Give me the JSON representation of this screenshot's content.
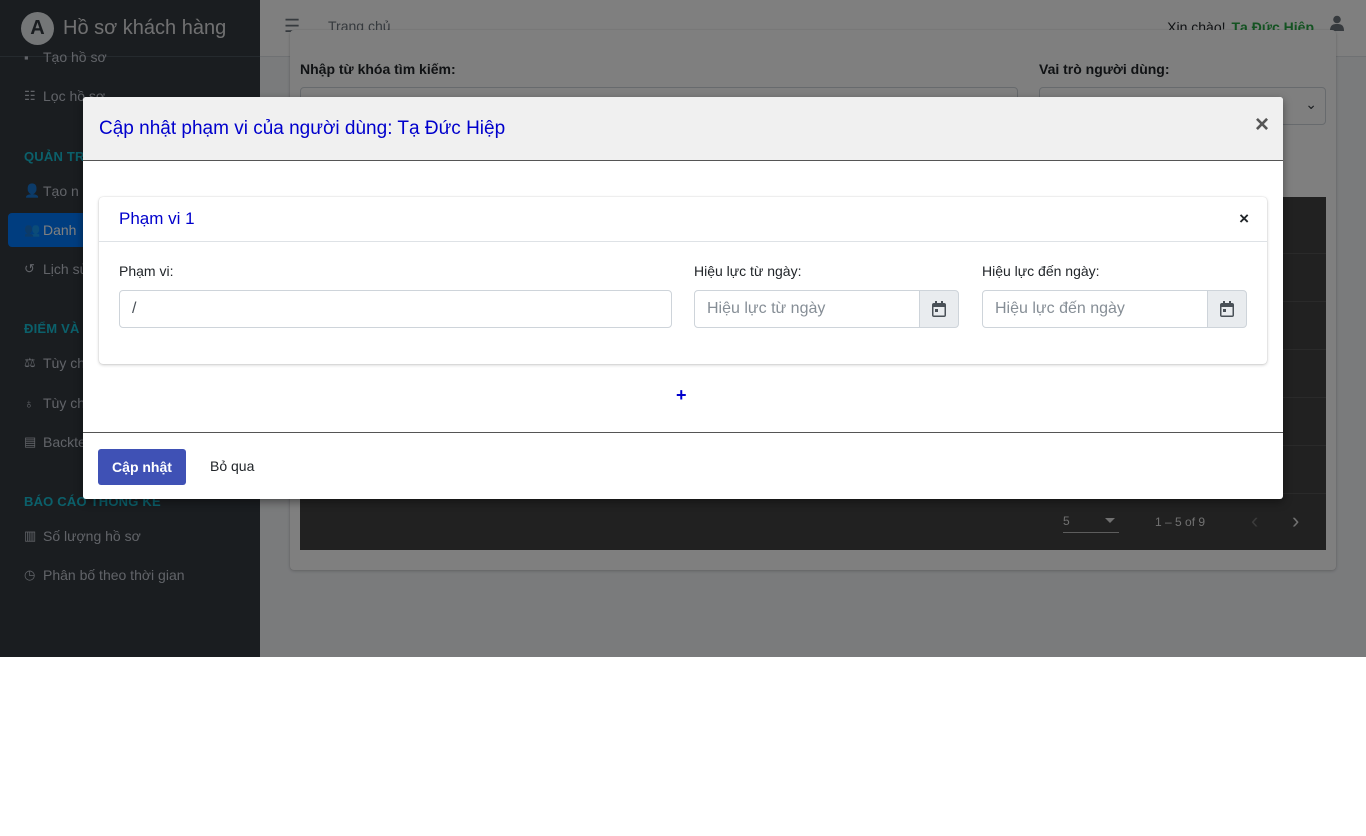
{
  "sidebar": {
    "brand": "Hồ sơ khách hàng",
    "brand_logo_letter": "A",
    "items": [
      {
        "label": "Tạo hồ sơ",
        "icon": "file-icon"
      },
      {
        "label": "Lọc hồ sơ",
        "icon": "list-icon"
      },
      {
        "label": "Tạo n",
        "icon": "user-plus-icon"
      },
      {
        "label": "Danh",
        "icon": "users-icon",
        "active": true
      },
      {
        "label": "Lịch sử",
        "icon": "history-icon"
      },
      {
        "label": "Tùy ch",
        "icon": "balance-scale-icon"
      },
      {
        "label": "Tùy chi",
        "icon": "award-icon"
      },
      {
        "label": "Backte",
        "icon": "cash-register-icon"
      },
      {
        "label": "Số lượng hồ sơ",
        "icon": "chart-bar-icon"
      },
      {
        "label": "Phân bố theo thời gian",
        "icon": "clock-icon"
      }
    ],
    "headers": [
      "QUẢN TR",
      "ĐIỂM VÀ",
      "BÁO CÁO THỐNG KÊ"
    ]
  },
  "navbar": {
    "home_link": "Trang chủ",
    "greeting": "Xin chào!",
    "username": "Tạ Đức Hiệp"
  },
  "filter": {
    "keyword_label": "Nhập từ khóa tìm kiếm:",
    "role_label": "Vai trò người dùng:"
  },
  "pagination": {
    "page_size": "5",
    "range": "1 – 5 of 9"
  },
  "modal": {
    "title": "Cập nhật phạm vi của người dùng: Tạ Đức Hiệp",
    "close": "×",
    "scope": {
      "title": "Phạm vi 1",
      "close": "×",
      "scope_label": "Phạm vi:",
      "scope_value": "/",
      "from_label": "Hiệu lực từ ngày:",
      "from_placeholder": "Hiệu lực từ ngày",
      "to_label": "Hiệu lực đến ngày:",
      "to_placeholder": "Hiệu lực đến ngày"
    },
    "add": "+",
    "update_button": "Cập nhật",
    "skip_button": "Bỏ qua"
  },
  "colors": {
    "sidebar_bg": "#343a40",
    "active_bg": "#007bff",
    "modal_title": "#0000cc",
    "update_button": "#3f51b5",
    "username": "#28a745"
  }
}
